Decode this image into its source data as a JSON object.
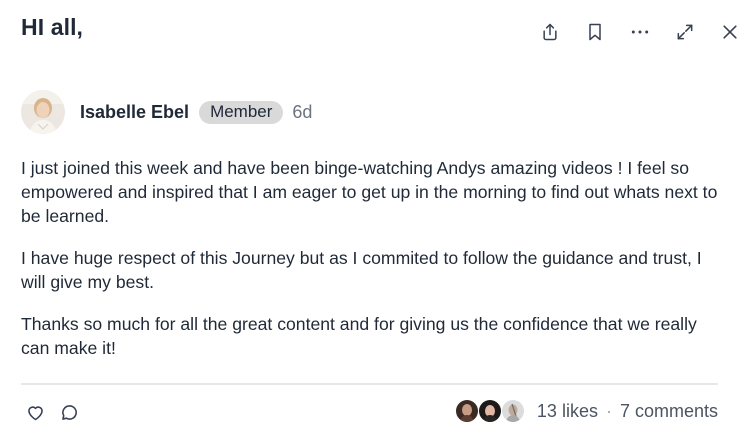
{
  "post": {
    "title": "HI all,",
    "author": {
      "name": "Isabelle Ebel",
      "badge": "Member",
      "age": "6d"
    },
    "paragraphs": [
      "I just joined this week and have been binge-watching Andys amazing videos ! I feel so empowered and inspired that I am eager to get up in the morning to find out whats next to be learned.",
      "I have huge respect of this Journey but as I commited to follow the guidance and trust, I will give my best.",
      "Thanks so much for all the great content and for giving us the confidence that we really can make it!"
    ]
  },
  "toolbar": {
    "icons": [
      "share-icon",
      "bookmark-icon",
      "more-icon",
      "expand-icon",
      "close-icon"
    ]
  },
  "footer": {
    "likes": "13 likes",
    "separator": "·",
    "comments": "7 comments"
  },
  "colors": {
    "text": "#1f2937",
    "muted": "#6b7280",
    "badge_bg": "#d9d9d9",
    "divider": "#e5e7eb"
  }
}
